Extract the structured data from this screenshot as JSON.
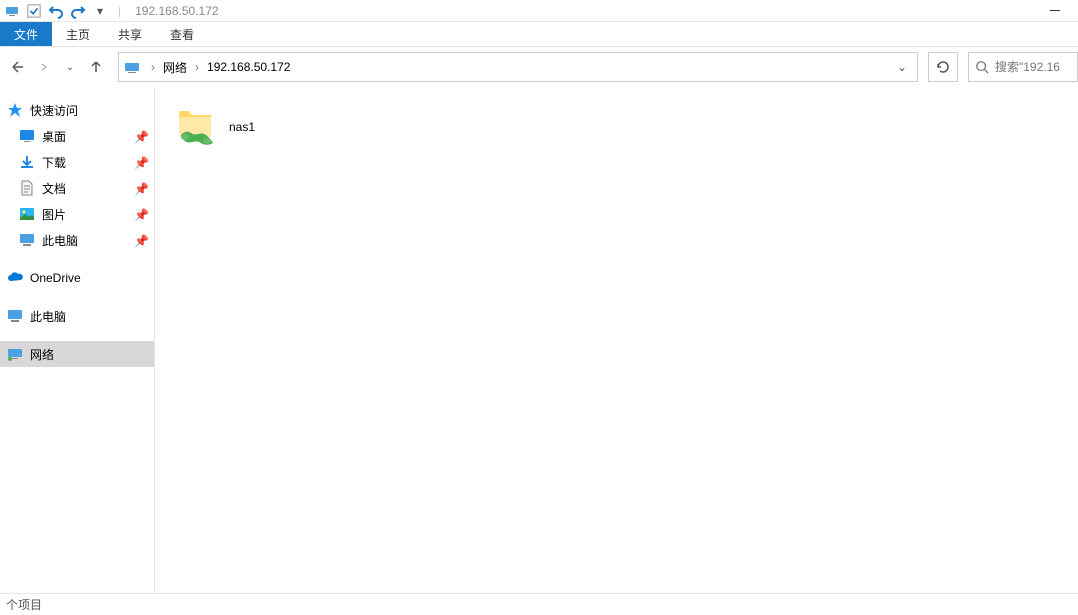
{
  "title": "192.168.50.172",
  "ribbon": {
    "file": "文件",
    "home": "主页",
    "share": "共享",
    "view": "查看"
  },
  "breadcrumb": {
    "items": [
      "网络",
      "192.168.50.172"
    ]
  },
  "search": {
    "placeholder": "搜索\"192.16"
  },
  "sidebar": {
    "quick_access": "快速访问",
    "desktop": "桌面",
    "downloads": "下载",
    "documents": "文档",
    "pictures": "图片",
    "this_pc_pin": "此电脑",
    "onedrive": "OneDrive",
    "this_pc": "此电脑",
    "network": "网络"
  },
  "content": {
    "items": [
      {
        "name": "nas1"
      }
    ]
  },
  "status": {
    "text": "个项目"
  }
}
